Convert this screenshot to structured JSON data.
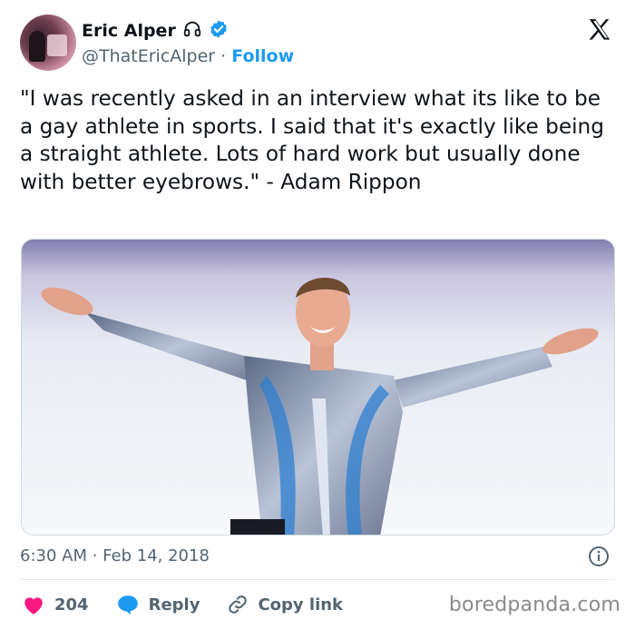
{
  "author": {
    "name": "Eric Alper",
    "handle": "@ThatEricAlper",
    "separator": "·",
    "follow_label": "Follow",
    "verified_color": "#1d9bf0"
  },
  "tweet": {
    "text": "\"I was recently asked in an interview what its like to be a gay athlete in sports. I said that it's exactly like being a straight athlete. Lots of hard work but usually done with better eyebrows.\" - Adam Rippon",
    "timestamp": "6:30 AM · Feb 14, 2018"
  },
  "actions": {
    "like_count": "204",
    "reply_label": "Reply",
    "copy_label": "Copy link",
    "like_color": "#f91880",
    "reply_color": "#1d9bf0"
  },
  "icons": {
    "headphones": "headphones-icon",
    "verified": "verified-badge-icon",
    "logo": "x-logo-icon",
    "info": "info-icon",
    "like": "heart-icon",
    "reply": "reply-bubble-icon",
    "copy": "link-icon"
  },
  "watermark": "boredpanda.com"
}
